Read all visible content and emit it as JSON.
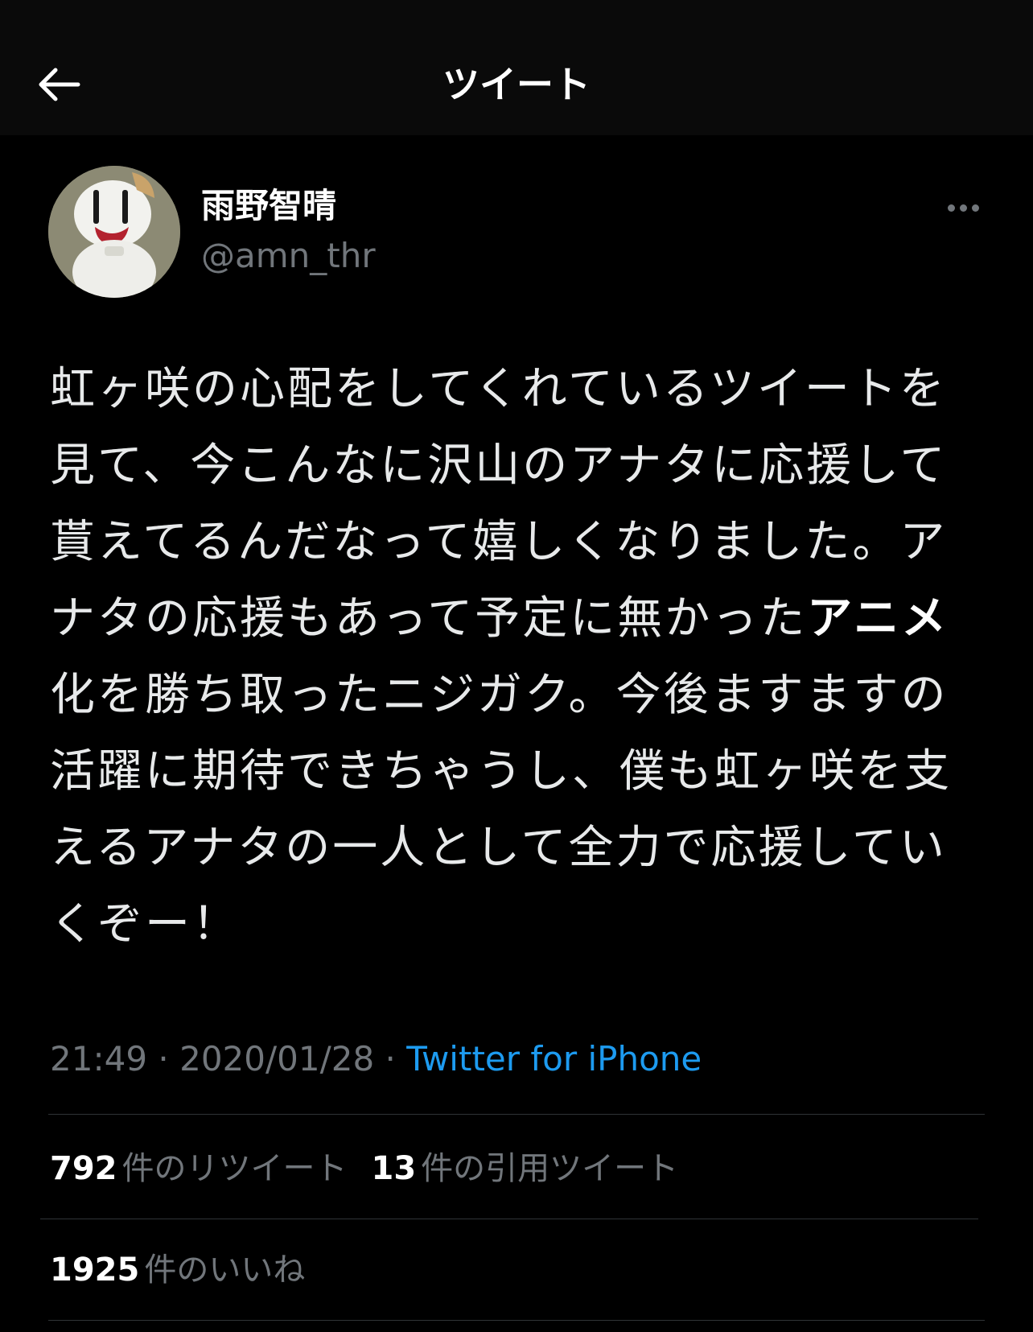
{
  "header": {
    "title": "ツイート",
    "back_icon": "arrow-left-icon"
  },
  "author": {
    "display_name": "雨野智晴",
    "handle": "@amn_thr",
    "avatar_icon": "avatar"
  },
  "more_icon": "more-horizontal-icon",
  "tweet": {
    "text_part1": "虹ヶ咲の心配をしてくれているツイートを見て、今こんなに沢山のアナタに応援して貰えてるんだなって嬉しくなりました。アナタの応援もあって予定に無かった",
    "text_bold": "アニメ",
    "text_part2": "化を勝ち取ったニジガク。今後ますますの活躍に期待できちゃうし、僕も虹ヶ咲を支えるアナタの一人として全力で応援していくぞー！"
  },
  "meta": {
    "time": "21:49",
    "separator": " · ",
    "date": "2020/01/28",
    "source": "Twitter for iPhone"
  },
  "stats": {
    "retweets_count": "792",
    "retweets_label": "件のリツイート",
    "quotes_count": "13",
    "quotes_label": "件の引用ツイート",
    "likes_count": "1925",
    "likes_label": "件のいいね"
  },
  "colors": {
    "background": "#000000",
    "text": "#e7e9ea",
    "muted": "#71767b",
    "link": "#1d9bf0",
    "divider": "#2f3336"
  }
}
